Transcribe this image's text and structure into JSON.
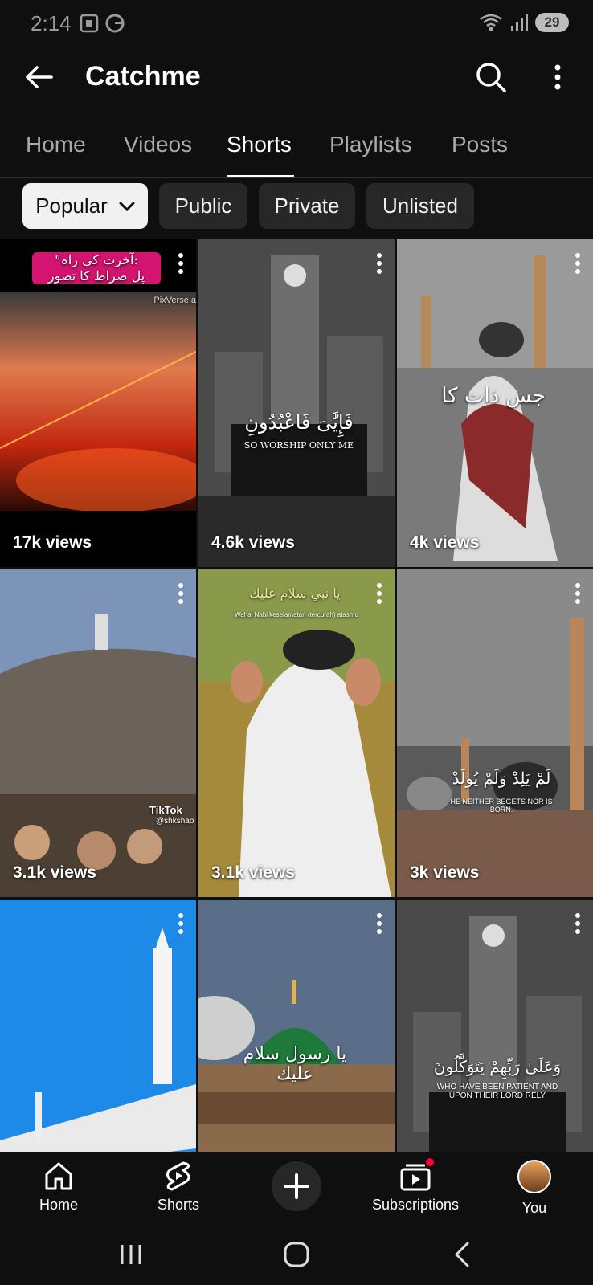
{
  "status_bar": {
    "time": "2:14",
    "battery": "29",
    "icons_left": [
      "screenshot-icon",
      "g-icon"
    ],
    "icons_right": [
      "wifi-icon",
      "signal-icon",
      "battery-icon"
    ]
  },
  "header": {
    "title": "Catchme",
    "back_icon": "arrow-left-icon",
    "search_icon": "search-icon",
    "more_icon": "more-vert-icon"
  },
  "tabs": [
    {
      "label": "Home",
      "active": false
    },
    {
      "label": "Videos",
      "active": false
    },
    {
      "label": "Shorts",
      "active": true
    },
    {
      "label": "Playlists",
      "active": false
    },
    {
      "label": "Posts",
      "active": false
    }
  ],
  "chips": [
    {
      "label": "Popular",
      "selected": true
    },
    {
      "label": "Public",
      "selected": false
    },
    {
      "label": "Private",
      "selected": false
    },
    {
      "label": "Unlisted",
      "selected": false
    }
  ],
  "shorts": [
    {
      "views": "17k views",
      "overlay": "\"آخرت کی راہ:\nپل صراط کا تصور",
      "watermark": "PixVerse.a"
    },
    {
      "views": "4.6k views",
      "overlay": "فَإِيَّٰىَ فَاعْبُدُونِ",
      "subtitle": "SO WORSHIP ONLY ME"
    },
    {
      "views": "4k views",
      "overlay": "جس ذات کا"
    },
    {
      "views": "3.1k views",
      "watermark": "TikTok",
      "handle": "@shkshao"
    },
    {
      "views": "3.1k views",
      "overlay": "يا نبي سلام عليك",
      "subtitle": "Wahai Nabi keselamatan (tercurah) atasmu"
    },
    {
      "views": "3k views",
      "overlay": "لَمْ يَلِدْ وَلَمْ يُولَدْ",
      "subtitle": "HE NEITHER BEGETS NOR IS BORN."
    },
    {
      "views": "",
      "overlay": ""
    },
    {
      "views": "",
      "overlay": "يا رسول سلام عليك"
    },
    {
      "views": "",
      "overlay": "وَعَلَىٰ رَبِّهِمْ يَتَوَكَّلُونَ",
      "subtitle": "WHO HAVE BEEN PATIENT AND UPON THEIR LORD RELY"
    }
  ],
  "bottom_nav": [
    {
      "label": "Home",
      "icon": "home-icon"
    },
    {
      "label": "Shorts",
      "icon": "shorts-icon"
    },
    {
      "label": "",
      "icon": "plus-icon"
    },
    {
      "label": "Subscriptions",
      "icon": "subscriptions-icon"
    },
    {
      "label": "You",
      "icon": "avatar"
    }
  ]
}
